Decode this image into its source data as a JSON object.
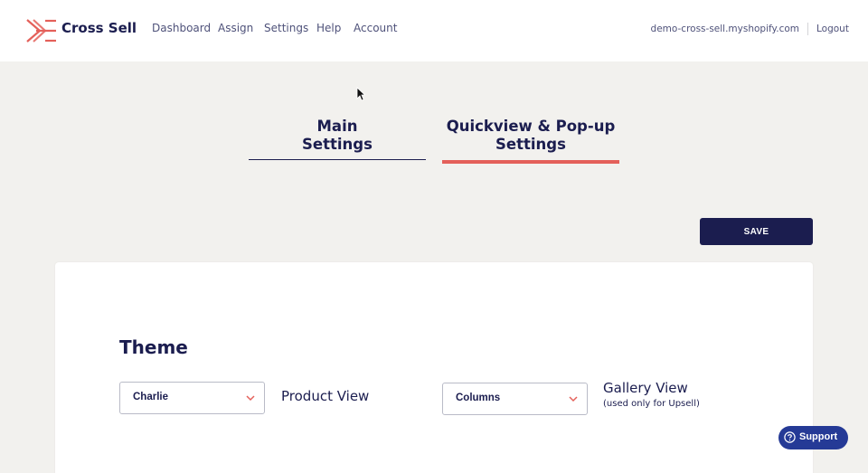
{
  "header": {
    "brand": "Cross Sell",
    "logo_color": "#e4605a",
    "nav": [
      "Dashboard",
      "Assign",
      "Settings",
      "Help",
      "Account"
    ],
    "shop_domain": "demo-cross-sell.myshopify.com",
    "logout_label": "Logout"
  },
  "tabs": {
    "main_line1": "Main",
    "main_line2": "Settings",
    "quick_line1": "Quickview & Pop-up",
    "quick_line2": "Settings",
    "active": "Quickview & Pop-up Settings",
    "active_color": "#e4605a"
  },
  "actions": {
    "save_label": "SAVE"
  },
  "theme": {
    "title": "Theme",
    "product_view_value": "Charlie",
    "product_view_label": "Product View",
    "gallery_view_value": "Columns",
    "gallery_view_label": "Gallery View",
    "gallery_view_note": "(used only for Upsell)"
  },
  "support": {
    "label": "Support",
    "icon": "question-circle-icon"
  },
  "colors": {
    "navy": "#1b1d4f",
    "accent": "#e4605a",
    "support_blue": "#253a96"
  }
}
